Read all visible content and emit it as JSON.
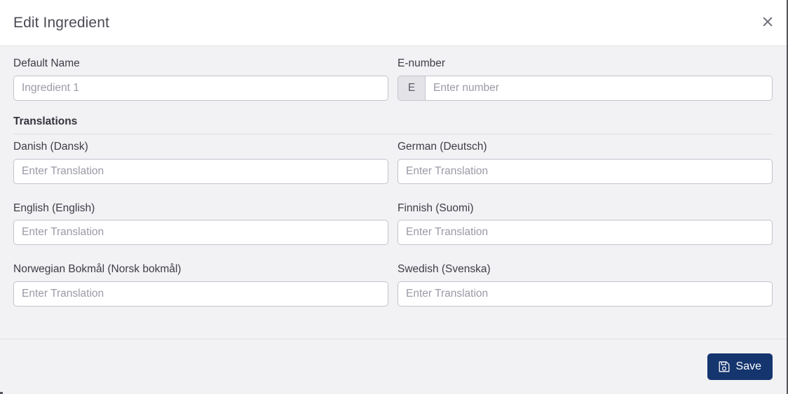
{
  "dialog": {
    "title": "Edit Ingredient",
    "close_label": "×",
    "close_icon": "close-icon"
  },
  "form": {
    "default_name": {
      "label": "Default Name",
      "placeholder": "Ingredient 1",
      "value": ""
    },
    "enumber": {
      "label": "E-number",
      "prefix": "E",
      "placeholder": "Enter number",
      "value": ""
    },
    "translations_heading": "Translations",
    "translation_placeholder": "Enter Translation",
    "translations": [
      {
        "label": "Danish (Dansk)",
        "placeholder": "Enter Translation",
        "value": ""
      },
      {
        "label": "German (Deutsch)",
        "placeholder": "Enter Translation",
        "value": ""
      },
      {
        "label": "English (English)",
        "placeholder": "Enter Translation",
        "value": ""
      },
      {
        "label": "Finnish (Suomi)",
        "placeholder": "Enter Translation",
        "value": ""
      },
      {
        "label": "Norwegian Bokmål (Norsk bokmål)",
        "placeholder": "Enter Translation",
        "value": ""
      },
      {
        "label": "Swedish (Svenska)",
        "placeholder": "Enter Translation",
        "value": ""
      }
    ]
  },
  "footer": {
    "save_label": "Save",
    "save_icon": "floppy-disk-icon"
  },
  "colors": {
    "accent": "#15356e",
    "header_bg": "#ffffff",
    "body_bg": "#f2f2f4",
    "input_border": "#c2c3ce",
    "prefix_bg": "#e4e4e8",
    "label_text": "#3d3d47",
    "placeholder_text": "#9a9aa7",
    "title_text": "#4a4a55"
  }
}
